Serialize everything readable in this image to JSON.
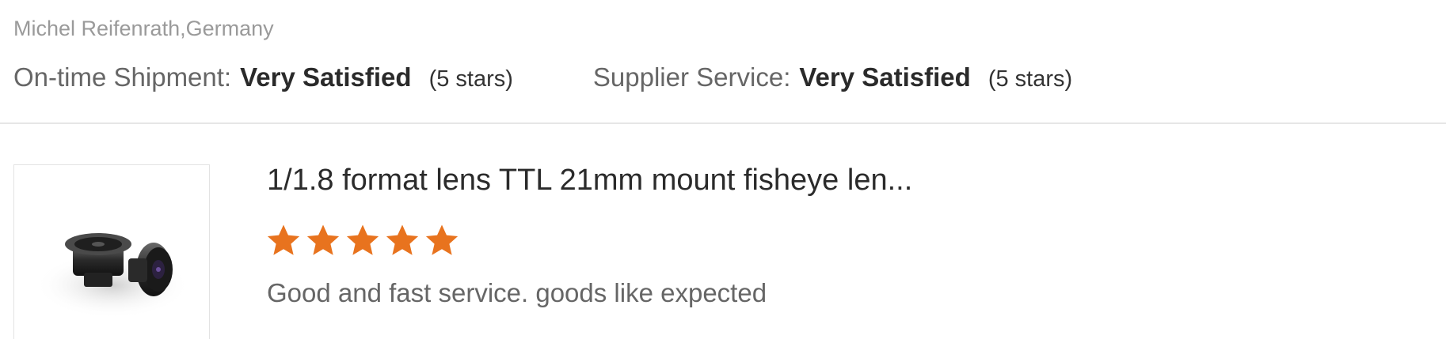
{
  "reviewer": {
    "name_location": "Michel Reifenrath,Germany"
  },
  "ratings": [
    {
      "label": "On-time Shipment:",
      "value": "Very Satisfied",
      "stars_text": "(5 stars)"
    },
    {
      "label": "Supplier Service:",
      "value": "Very Satisfied",
      "stars_text": "(5 stars)"
    }
  ],
  "product": {
    "title": "1/1.8 format lens TTL 21mm mount fisheye len...",
    "rating_stars": 5,
    "review_text": "Good and fast service. goods like expected",
    "thumbnail_icon": "lens-product-image"
  },
  "colors": {
    "star": "#e8731e",
    "divider": "#e6e6e6"
  }
}
